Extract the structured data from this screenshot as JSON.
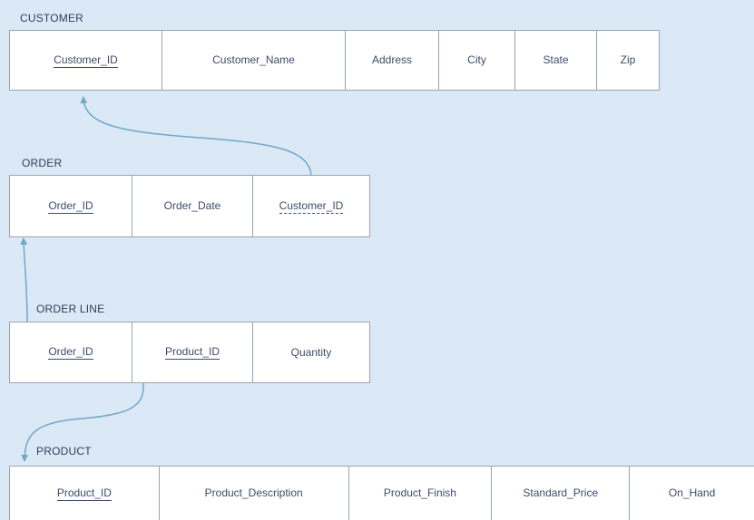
{
  "tables": {
    "customer": {
      "title": "CUSTOMER",
      "columns": [
        {
          "label": "Customer_ID",
          "key": "pk"
        },
        {
          "label": "Customer_Name",
          "key": "none"
        },
        {
          "label": "Address",
          "key": "none"
        },
        {
          "label": "City",
          "key": "none"
        },
        {
          "label": "State",
          "key": "none"
        },
        {
          "label": "Zip",
          "key": "none"
        }
      ]
    },
    "order": {
      "title": "ORDER",
      "columns": [
        {
          "label": "Order_ID",
          "key": "pk"
        },
        {
          "label": "Order_Date",
          "key": "none"
        },
        {
          "label": "Customer_ID",
          "key": "fk"
        }
      ]
    },
    "order_line": {
      "title": "ORDER LINE",
      "columns": [
        {
          "label": "Order_ID",
          "key": "pk"
        },
        {
          "label": "Product_ID",
          "key": "pk"
        },
        {
          "label": "Quantity",
          "key": "none"
        }
      ]
    },
    "product": {
      "title": "PRODUCT",
      "columns": [
        {
          "label": "Product_ID",
          "key": "pk"
        },
        {
          "label": "Product_Description",
          "key": "none"
        },
        {
          "label": "Product_Finish",
          "key": "none"
        },
        {
          "label": "Standard_Price",
          "key": "none"
        },
        {
          "label": "On_Hand",
          "key": "none"
        }
      ]
    }
  },
  "colors": {
    "background": "#dbe9f6",
    "table_border": "#9aa3b2",
    "link": "#6fa8c8",
    "text": "#3d4c6a"
  }
}
